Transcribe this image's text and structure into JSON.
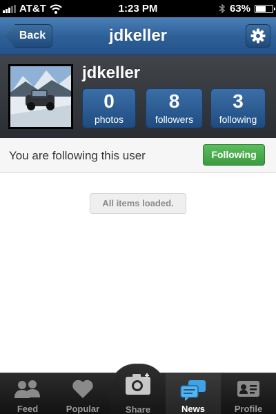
{
  "status_bar": {
    "carrier": "AT&T",
    "time": "1:23 PM",
    "battery": "63%",
    "battery_level": 0.63
  },
  "nav": {
    "back_label": "Back",
    "title": "jdkeller"
  },
  "profile": {
    "username": "jdkeller",
    "stats": [
      {
        "value": "0",
        "label": "photos"
      },
      {
        "value": "8",
        "label": "followers"
      },
      {
        "value": "3",
        "label": "following"
      }
    ]
  },
  "follow": {
    "text": "You are following this user",
    "button_label": "Following",
    "button_color": "#4caf50"
  },
  "list": {
    "status": "All items loaded."
  },
  "tabs": [
    {
      "label": "Feed",
      "icon": "users-icon",
      "active": false
    },
    {
      "label": "Popular",
      "icon": "heart-icon",
      "active": false
    },
    {
      "label": "Share",
      "icon": "camera-icon",
      "active": false
    },
    {
      "label": "News",
      "icon": "chat-bubbles-icon",
      "active": true
    },
    {
      "label": "Profile",
      "icon": "id-card-icon",
      "active": false
    }
  ],
  "colors": {
    "accent_blue": "#2d5f97",
    "active_tab_icon": "#3fa2e6"
  }
}
